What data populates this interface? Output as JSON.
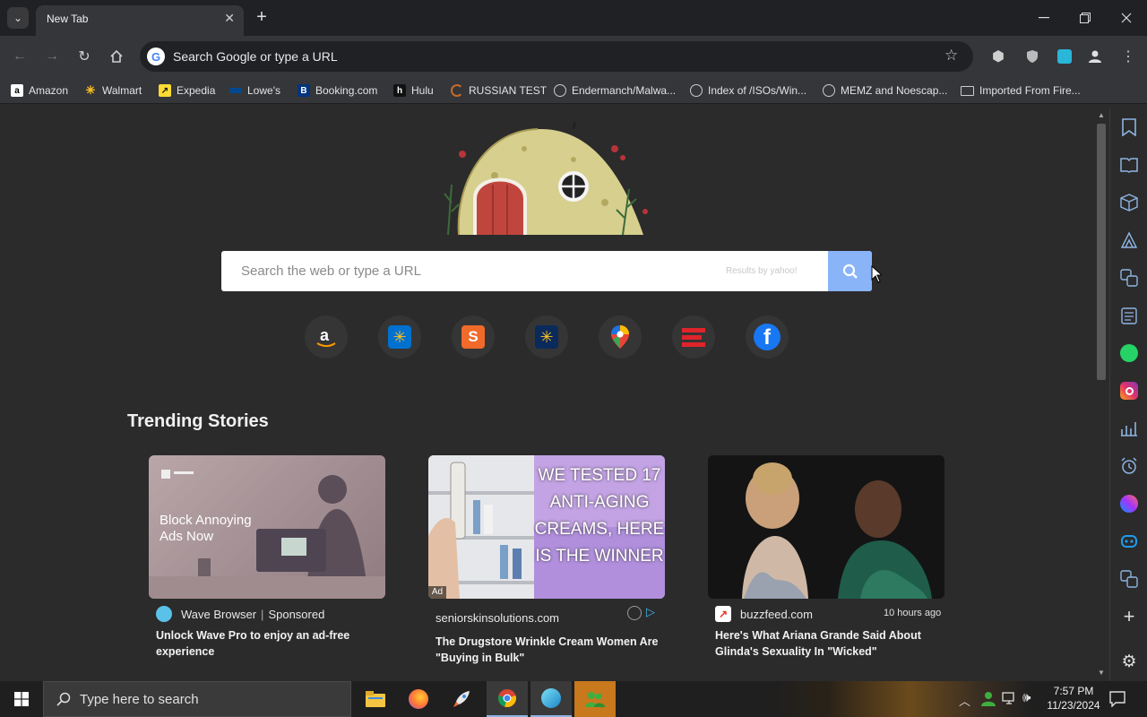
{
  "browser": {
    "tab_title": "New Tab",
    "omnibox_placeholder": "Search Google or type a URL"
  },
  "bookmarks": [
    {
      "label": "Amazon",
      "icon": "amazon-icon"
    },
    {
      "label": "Walmart",
      "icon": "walmart-icon"
    },
    {
      "label": "Expedia",
      "icon": "expedia-icon"
    },
    {
      "label": "Lowe's",
      "icon": "lowes-icon"
    },
    {
      "label": "Booking.com",
      "icon": "booking-icon"
    },
    {
      "label": "Hulu",
      "icon": "hulu-icon"
    },
    {
      "label": "RUSSIAN TEST",
      "icon": "loading-icon"
    },
    {
      "label": "Endermanch/Malwa...",
      "icon": "globe-icon"
    },
    {
      "label": "Index of /ISOs/Win...",
      "icon": "globe-icon"
    },
    {
      "label": "MEMZ and Noescap...",
      "icon": "globe-icon"
    },
    {
      "label": "Imported From Fire...",
      "icon": "folder-icon"
    }
  ],
  "search": {
    "placeholder": "Search the web or type a URL",
    "results_by": "Results by yahoo!"
  },
  "trending": {
    "title": "Trending Stories",
    "cards": [
      {
        "image_text": "Block Annoying Ads Now",
        "source": "Wave Browser",
        "sponsored": "Sponsored",
        "title": "Unlock Wave Pro to enjoy an ad-free experience"
      },
      {
        "image_text": "WE TESTED 17 ANTI-AGING CREAMS, HERE IS THE WINNER",
        "ad_label": "Ad",
        "source": "seniorskinsolutions.com",
        "title": "The Drugstore Wrinkle Cream Women Are \"Buying in Bulk\""
      },
      {
        "source": "buzzfeed.com",
        "time": "10 hours ago",
        "title": "Here's What Ariana Grande Said About Glinda's Sexuality In \"Wicked\""
      }
    ]
  },
  "taskbar": {
    "search_placeholder": "Type here to search",
    "time": "7:57 PM",
    "date": "11/23/2024"
  },
  "colors": {
    "search_button": "#8ab4f8",
    "page_bg": "#2b2b2b"
  }
}
